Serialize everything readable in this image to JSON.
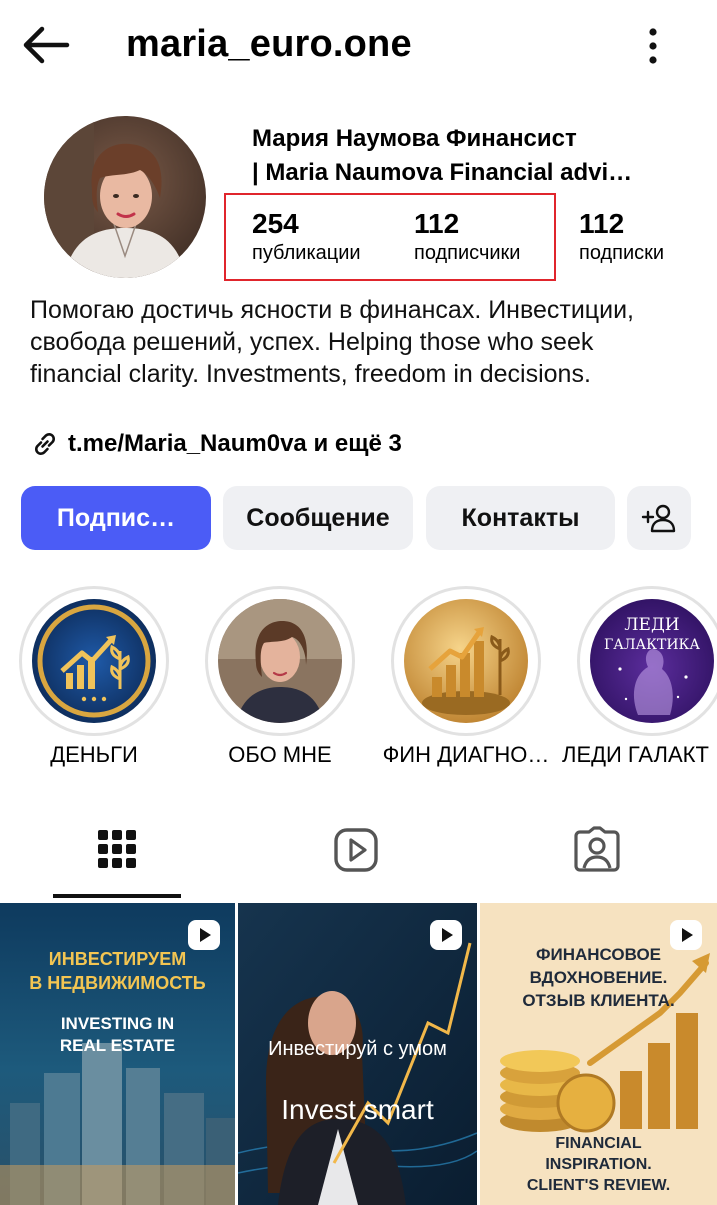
{
  "header": {
    "username": "maria_euro.one"
  },
  "profile": {
    "name_line1": "Мария Наумова Финансист",
    "name_line2": "| Maria Naumova Financial advi…",
    "stats": [
      {
        "value": "254",
        "label": "публикации"
      },
      {
        "value": "112",
        "label": "подписчики"
      },
      {
        "value": "112",
        "label": "подписки"
      }
    ],
    "bio": "Помогаю достичь ясности в финансах. Инвестиции, свобода решений, успех. Helping those who seek financial clarity. Investments, freedom in decisions.",
    "link": "t.me/Maria_Naum0va и ещё 3"
  },
  "buttons": {
    "follow": "Подпис…",
    "message": "Сообщение",
    "contacts": "Контакты"
  },
  "highlights": [
    {
      "label": "ДЕНЬГИ"
    },
    {
      "label": "ОБО МНЕ"
    },
    {
      "label": "ФИН ДИАГНО…"
    },
    {
      "label": "ЛЕДИ ГАЛАКТ",
      "text1": "ЛЕДИ",
      "text2": "ГАЛАКТИКА"
    }
  ],
  "posts": [
    {
      "ru1": "ИНВЕСТИРУЕМ",
      "ru2": "В НЕДВИЖИМОСТЬ",
      "en1": "INVESTING IN",
      "en2": "REAL ESTATE"
    },
    {
      "ru1": "Инвестируй с умом",
      "en1": "Invest smart"
    },
    {
      "ru1": "ФИНАНСОВОЕ",
      "ru2": "ВДОХНОВЕНИЕ.",
      "ru3": "ОТЗЫВ КЛИЕНТА.",
      "en1": "FINANCIAL",
      "en2": "INSPIRATION.",
      "en3": "CLIENT'S REVIEW."
    }
  ],
  "colors": {
    "accent": "#4b5cf6",
    "highlight_box": "#e0252c",
    "button_bg": "#eff0f3"
  },
  "icons": [
    "back-arrow-icon",
    "more-vertical-icon",
    "link-icon",
    "add-user-icon",
    "grid-icon",
    "reels-icon",
    "tagged-icon",
    "reel-badge-icon"
  ]
}
